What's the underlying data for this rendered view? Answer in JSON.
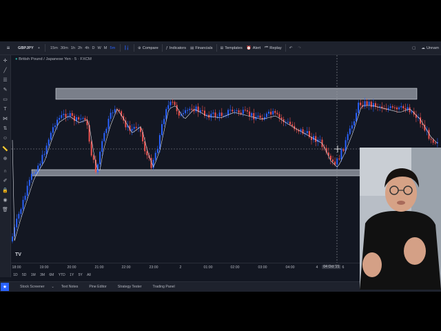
{
  "toolbar": {
    "menu_icon": "hamburger-icon",
    "symbol": "GBPJPY",
    "timeframes": [
      "15m",
      "30m",
      "1h",
      "2h",
      "4h",
      "D",
      "W",
      "M",
      "5m"
    ],
    "active_timeframe_index": 8,
    "compare": "Compare",
    "indicators": "Indicators",
    "financials": "Financials",
    "templates": "Templates",
    "alert": "Alert",
    "replay": "Replay",
    "undo_icon": "undo-icon",
    "user": "Unnam"
  },
  "chart": {
    "title": "British Pound / Japanese Yen · 5 · FXCM",
    "watermark": "TV",
    "x_axis_labels": [
      "18:00",
      "19:00",
      "20:00",
      "21:00",
      "22:00",
      "23:00",
      "2",
      "01:00",
      "02:00",
      "03:00",
      "04:00",
      "4",
      "6"
    ],
    "crosshair_label": "04 Oct '21",
    "colors": {
      "up": "#2962ff",
      "down": "#ef5350",
      "background": "#131722",
      "zone": "#cfd6e0",
      "ma": "#e0e3eb"
    }
  },
  "chart_data": {
    "type": "candlestick",
    "title": "British Pound / Japanese Yen · 5 · FXCM",
    "x_tick_labels": [
      "18:00",
      "19:00",
      "20:00",
      "21:00",
      "22:00",
      "23:00",
      "2",
      "01:00",
      "02:00",
      "03:00",
      "04:00",
      "4",
      "6"
    ],
    "overlays": [
      "resistance-zone",
      "support-zone",
      "moving-average"
    ],
    "crosshair": "04 Oct '21"
  },
  "ranges": [
    "1D",
    "5D",
    "1M",
    "3M",
    "6M",
    "YTD",
    "1Y",
    "5Y",
    "All"
  ],
  "bottom": {
    "tabs": [
      "Stock Screener",
      "Text Notes",
      "Pine Editor",
      "Strategy Tester",
      "Trading Panel"
    ]
  },
  "webcam": {
    "label": "presenter webcam"
  }
}
